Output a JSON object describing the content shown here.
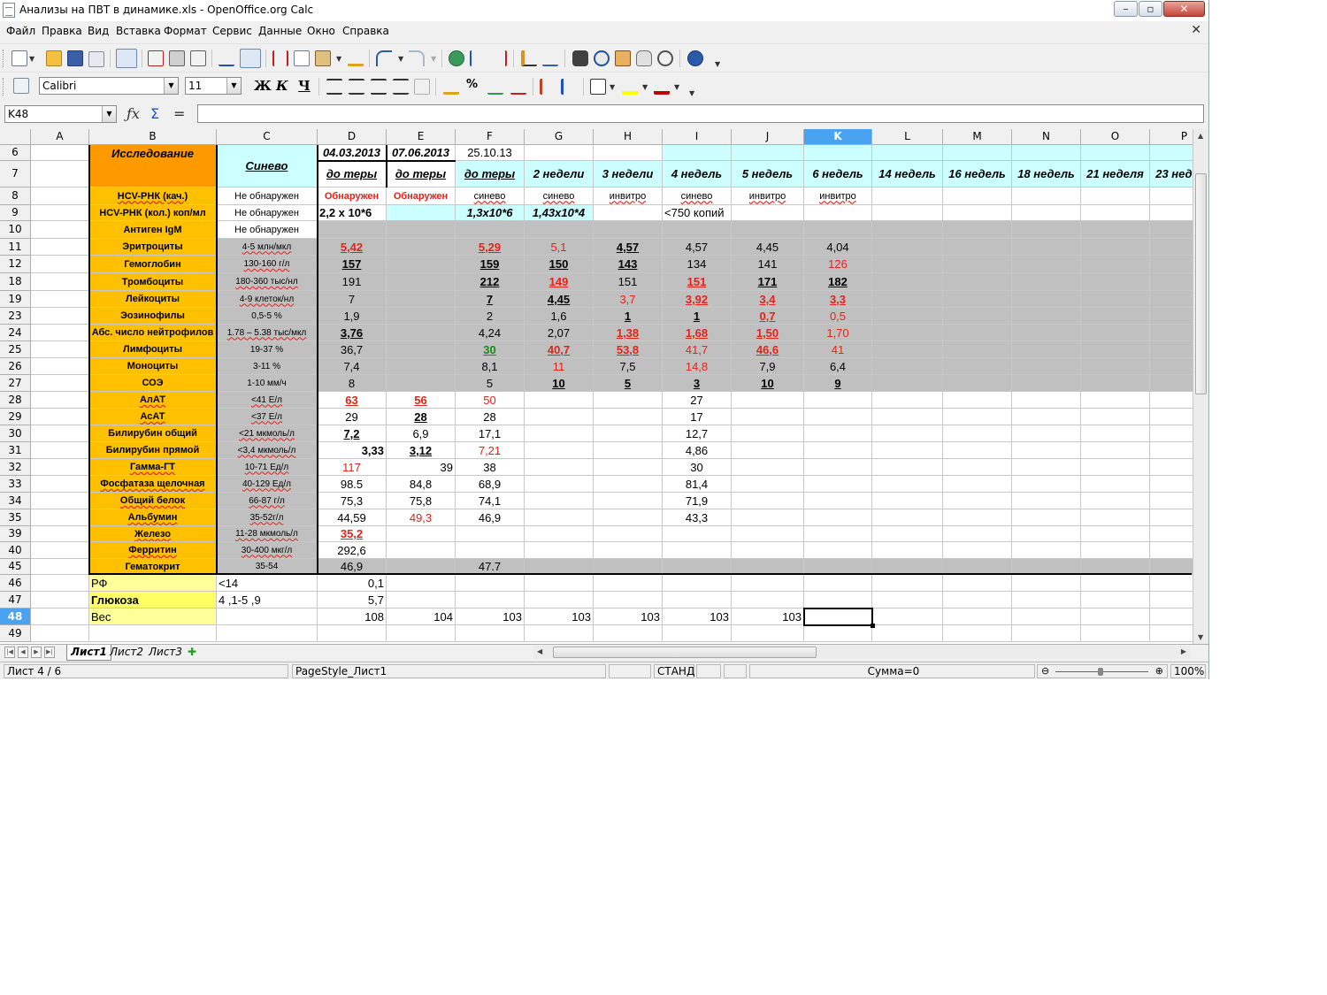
{
  "window": {
    "title": "Анализы на ПВТ в динамике.xls - OpenOffice.org Calc",
    "minimize": "–",
    "maximize": "▫",
    "close": "✕"
  },
  "menu": [
    "Файл",
    "Правка",
    "Вид",
    "Вставка",
    "Формат",
    "Сервис",
    "Данные",
    "Окно",
    "Справка"
  ],
  "menu_close": "✕",
  "format_bar": {
    "font_name": "Calibri",
    "font_size": "11",
    "bold": "Ж",
    "italic": "К",
    "underline": "Ч"
  },
  "formula_bar": {
    "name_box": "K48",
    "input": ""
  },
  "columns": [
    "A",
    "B",
    "C",
    "D",
    "E",
    "F",
    "G",
    "H",
    "I",
    "J",
    "K",
    "L",
    "M",
    "N",
    "O",
    "P"
  ],
  "selected_column": "K",
  "rows": [
    {
      "num": "6",
      "cells": [
        "",
        "Исследование",
        "Синево",
        "04.03.2013",
        "07.06.2013",
        "25.10.13",
        "",
        "",
        "",
        "",
        "",
        "",
        "",
        "",
        "",
        ""
      ]
    },
    {
      "num": "7",
      "cells": [
        "",
        "",
        "",
        "до теры",
        "до теры",
        "до теры",
        "2 недели",
        "3 недели",
        "4  недель",
        "5 недель",
        "6  недель",
        "14 недель",
        "16 недель",
        "18 недель",
        "21 неделя",
        "23 недель"
      ]
    },
    {
      "num": "8",
      "cells": [
        "",
        "HCV-РНК (кач.)",
        "Не обнаружен",
        "Обнаружен",
        "Обнаружен",
        "синево",
        "синево",
        "инвитро",
        "синево",
        "инвитро",
        "инвитро",
        "",
        "",
        "",
        "",
        ""
      ]
    },
    {
      "num": "9",
      "cells": [
        "",
        "HCV-РНК (кол.) коп/мл",
        "Не обнаружен",
        "2,2 x 10*6",
        "",
        "1,3х10*6",
        "1,43х10*4",
        "",
        "<750 копий",
        "",
        "",
        "",
        "",
        "",
        "",
        ""
      ]
    },
    {
      "num": "10",
      "cells": [
        "",
        "Антиген IgM",
        "Не обнаружен",
        "",
        "",
        "",
        "",
        "",
        "",
        "",
        "",
        "",
        "",
        "",
        "",
        ""
      ]
    },
    {
      "num": "11",
      "cells": [
        "",
        "Эритроциты",
        "4-5 млн/мкл",
        "5,42",
        "",
        "5,29",
        "5,1",
        "4,57",
        "4,57",
        "4,45",
        "4,04",
        "",
        "",
        "",
        "",
        ""
      ]
    },
    {
      "num": "12",
      "cells": [
        "",
        "Гемоглобин",
        "130-160 г/л",
        "157",
        "",
        "159",
        "150",
        "143",
        "134",
        "141",
        "126",
        "",
        "",
        "",
        "",
        ""
      ]
    },
    {
      "num": "18",
      "cells": [
        "",
        "Тромбоциты",
        "180-360 тыс/нл",
        "191",
        "",
        "212",
        "149",
        "151",
        "151",
        "171",
        "182",
        "",
        "",
        "",
        "",
        ""
      ]
    },
    {
      "num": "19",
      "cells": [
        "",
        "Лейкоциты",
        "4-9 клеток/нл",
        "7",
        "",
        "7",
        "4,45",
        "3,7",
        "3,92",
        "3,4",
        "3,3",
        "",
        "",
        "",
        "",
        ""
      ]
    },
    {
      "num": "23",
      "cells": [
        "",
        "Эозинофилы",
        "0,5-5 %",
        "1,9",
        "",
        "2",
        "1,6",
        "1",
        "1",
        "0,7",
        "0,5",
        "",
        "",
        "",
        "",
        ""
      ]
    },
    {
      "num": "24",
      "cells": [
        "",
        "Абс. число нейтрофилов",
        "1.78 – 5.38 тыс/мкл",
        "3,76",
        "",
        "4,24",
        "2,07",
        "1,38",
        "1,68",
        "1,50",
        "1,70",
        "",
        "",
        "",
        "",
        ""
      ]
    },
    {
      "num": "25",
      "cells": [
        "",
        "Лимфоциты",
        "19-37 %",
        "36,7",
        "",
        "30",
        "40,7",
        "53,8",
        "41,7",
        "46,6",
        "41",
        "",
        "",
        "",
        "",
        ""
      ]
    },
    {
      "num": "26",
      "cells": [
        "",
        "Моноциты",
        "3-11 %",
        "7,4",
        "",
        "8,1",
        "11",
        "7,5",
        "14,8",
        "7,9",
        "6,4",
        "",
        "",
        "",
        "",
        ""
      ]
    },
    {
      "num": "27",
      "cells": [
        "",
        "СОЭ",
        "1-10 мм/ч",
        "8",
        "",
        "5",
        "10",
        "5",
        "3",
        "10",
        "9",
        "",
        "",
        "",
        "",
        ""
      ]
    },
    {
      "num": "28",
      "cells": [
        "",
        "АлАТ",
        "<41 Е/л",
        "63",
        "56",
        "50",
        "",
        "",
        "27",
        "",
        "",
        "",
        "",
        "",
        "",
        ""
      ]
    },
    {
      "num": "29",
      "cells": [
        "",
        "АсАТ",
        "<37 Е/л",
        "29",
        "28",
        "28",
        "",
        "",
        "17",
        "",
        "",
        "",
        "",
        "",
        "",
        ""
      ]
    },
    {
      "num": "30",
      "cells": [
        "",
        "Билирубин общий",
        "<21 мкмоль/л",
        "7,2",
        "6,9",
        "17,1",
        "",
        "",
        "12,7",
        "",
        "",
        "",
        "",
        "",
        "",
        ""
      ]
    },
    {
      "num": "31",
      "cells": [
        "",
        "Билирубин прямой",
        "<3,4 мкмоль/л",
        "3,33",
        "3,12",
        "7,21",
        "",
        "",
        "4,86",
        "",
        "",
        "",
        "",
        "",
        "",
        ""
      ]
    },
    {
      "num": "32",
      "cells": [
        "",
        "Гамма-ГТ",
        "10-71 Ед/л",
        "117",
        "39",
        "38",
        "",
        "",
        "30",
        "",
        "",
        "",
        "",
        "",
        "",
        ""
      ]
    },
    {
      "num": "33",
      "cells": [
        "",
        "Фосфатаза щелочная",
        "40-129 Ед/л",
        "98.5",
        "84,8",
        "68,9",
        "",
        "",
        "81,4",
        "",
        "",
        "",
        "",
        "",
        "",
        ""
      ]
    },
    {
      "num": "34",
      "cells": [
        "",
        "Общий белок",
        "66-87 г/л",
        "75,3",
        "75,8",
        "74,1",
        "",
        "",
        "71,9",
        "",
        "",
        "",
        "",
        "",
        "",
        ""
      ]
    },
    {
      "num": "35",
      "cells": [
        "",
        "Альбумин",
        "35-52г/л",
        "44,59",
        "49,3",
        "46,9",
        "",
        "",
        "43,3",
        "",
        "",
        "",
        "",
        "",
        "",
        ""
      ]
    },
    {
      "num": "39",
      "cells": [
        "",
        "Железо",
        "11-28 мкмоль/л",
        "35,2",
        "",
        "",
        "",
        "",
        "",
        "",
        "",
        "",
        "",
        "",
        "",
        ""
      ]
    },
    {
      "num": "40",
      "cells": [
        "",
        "Ферритин",
        "30-400 мкг/л",
        "292,6",
        "",
        "",
        "",
        "",
        "",
        "",
        "",
        "",
        "",
        "",
        "",
        ""
      ]
    },
    {
      "num": "45",
      "cells": [
        "",
        "Гематокрит",
        "35-54",
        "46,9",
        "",
        "47.7",
        "",
        "",
        "",
        "",
        "",
        "",
        "",
        "",
        "",
        ""
      ]
    },
    {
      "num": "46",
      "cells": [
        "",
        "РФ",
        "<14",
        "0,1",
        "",
        "",
        "",
        "",
        "",
        "",
        "",
        "",
        "",
        "",
        "",
        ""
      ]
    },
    {
      "num": "47",
      "cells": [
        "",
        "Глюкоза",
        "4 ,1-5 ,9",
        "5,7",
        "",
        "",
        "",
        "",
        "",
        "",
        "",
        "",
        "",
        "",
        "",
        ""
      ]
    },
    {
      "num": "48",
      "cells": [
        "",
        "Вес",
        "",
        "108",
        "104",
        "103",
        "103",
        "103",
        "103",
        "103",
        "",
        "",
        "",
        "",
        "",
        ""
      ]
    },
    {
      "num": "49",
      "cells": [
        "",
        "",
        "",
        "",
        "",
        "",
        "",
        "",
        "",
        "",
        "",
        "",
        "",
        "",
        "",
        ""
      ]
    }
  ],
  "sheets": [
    "Лист1",
    "Лист2",
    "Лист3"
  ],
  "active_sheet": "Лист1",
  "status": {
    "sheet_pos": "Лист 4 / 6",
    "page_style": "PageStyle_Лист1",
    "mode": "СТАНД",
    "sum": "Сумма=0",
    "zoom": "100%"
  }
}
